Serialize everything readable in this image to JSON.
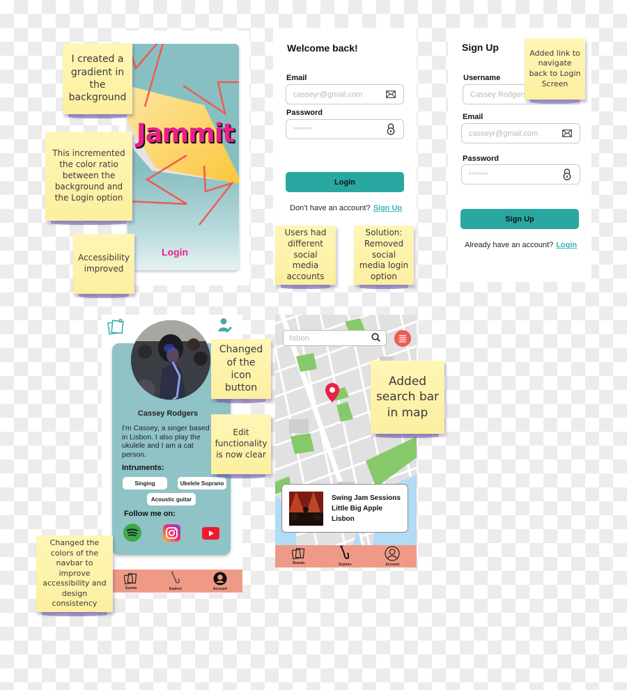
{
  "splash": {
    "brand": "Jammit",
    "login_label": "Login",
    "colors": {
      "brand": "#e91e8c",
      "background_top": "#87c0c3",
      "background_bottom": "#e6f2f3",
      "accent_shape": "#fcc940"
    }
  },
  "login_screen": {
    "title": "Welcome back!",
    "email_label": "Email",
    "email_placeholder": "casseyr@gmail.com",
    "password_label": "Password",
    "password_placeholder": "*******",
    "login_button": "Login",
    "footer_text": "Don’t have an account?",
    "footer_link": "Sign Up",
    "icons": {
      "email": "envelope-icon",
      "password": "lock-icon"
    }
  },
  "signup_screen": {
    "title": "Sign Up",
    "username_label": "Username",
    "username_placeholder": "Cassey Rodgers",
    "email_label": "Email",
    "email_placeholder": "casseyr@gmail.com",
    "password_label": "Password",
    "password_placeholder": "*******",
    "signup_button": "Sign Up",
    "footer_text": "Already have an account?",
    "footer_link": "Login"
  },
  "profile_screen": {
    "name": "Cassey Rodgers",
    "bio": "I'm Cassey, a singer based in Lisbon. I also play the ukulele and I am a cat person.",
    "instruments_label": "Intruments:",
    "instruments": [
      "Singing",
      "Ukelele Soprano",
      "Acoustic guitar"
    ],
    "follow_label": "Follow me on:",
    "socials": [
      "spotify",
      "instagram",
      "youtube"
    ],
    "navbar": [
      {
        "label": "Events",
        "icon": "boards-icon"
      },
      {
        "label": "Explore",
        "icon": "saxophone-icon"
      },
      {
        "label": "Account",
        "icon": "account-icon"
      }
    ]
  },
  "map_screen": {
    "search_value": "lisbon",
    "event_card": {
      "title": "Swing Jam Sessions",
      "venue": "Little Big Apple",
      "city": "Lisbon"
    },
    "navbar": [
      {
        "label": "Boards",
        "icon": "boards-icon"
      },
      {
        "label": "Explore",
        "icon": "saxophone-icon"
      },
      {
        "label": "Account",
        "icon": "account-icon"
      }
    ]
  },
  "notes": {
    "gradient": "I created a gradient in the background",
    "color_ratio": "This incremented the color ratio between the background and the Login option",
    "accessibility": "Accessibility improved",
    "social_problem": "Users had different social media accounts",
    "social_solution": "Solution: Removed social media login option",
    "back_link": "Added link to navigate back to Login Screen",
    "icon_button": "Changed of the icon button",
    "edit": "Edit functionality is now clear",
    "navbar_colors": "Changed the colors of the navbar to improve accessibility and design consistency",
    "search_bar": "Added search bar in map"
  }
}
